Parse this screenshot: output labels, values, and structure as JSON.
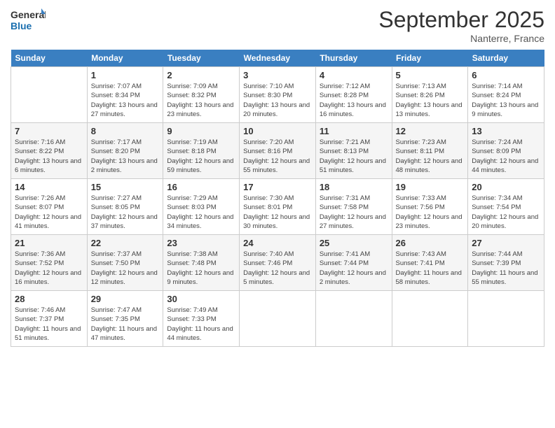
{
  "logo": {
    "line1": "General",
    "line2": "Blue"
  },
  "title": "September 2025",
  "subtitle": "Nanterre, France",
  "days": [
    "Sunday",
    "Monday",
    "Tuesday",
    "Wednesday",
    "Thursday",
    "Friday",
    "Saturday"
  ],
  "weeks": [
    [
      {
        "date": "",
        "sunrise": "",
        "sunset": "",
        "daylight": ""
      },
      {
        "date": "1",
        "sunrise": "7:07 AM",
        "sunset": "8:34 PM",
        "daylight": "13 hours and 27 minutes."
      },
      {
        "date": "2",
        "sunrise": "7:09 AM",
        "sunset": "8:32 PM",
        "daylight": "13 hours and 23 minutes."
      },
      {
        "date": "3",
        "sunrise": "7:10 AM",
        "sunset": "8:30 PM",
        "daylight": "13 hours and 20 minutes."
      },
      {
        "date": "4",
        "sunrise": "7:12 AM",
        "sunset": "8:28 PM",
        "daylight": "13 hours and 16 minutes."
      },
      {
        "date": "5",
        "sunrise": "7:13 AM",
        "sunset": "8:26 PM",
        "daylight": "13 hours and 13 minutes."
      },
      {
        "date": "6",
        "sunrise": "7:14 AM",
        "sunset": "8:24 PM",
        "daylight": "13 hours and 9 minutes."
      }
    ],
    [
      {
        "date": "7",
        "sunrise": "7:16 AM",
        "sunset": "8:22 PM",
        "daylight": "13 hours and 6 minutes."
      },
      {
        "date": "8",
        "sunrise": "7:17 AM",
        "sunset": "8:20 PM",
        "daylight": "13 hours and 2 minutes."
      },
      {
        "date": "9",
        "sunrise": "7:19 AM",
        "sunset": "8:18 PM",
        "daylight": "12 hours and 59 minutes."
      },
      {
        "date": "10",
        "sunrise": "7:20 AM",
        "sunset": "8:16 PM",
        "daylight": "12 hours and 55 minutes."
      },
      {
        "date": "11",
        "sunrise": "7:21 AM",
        "sunset": "8:13 PM",
        "daylight": "12 hours and 51 minutes."
      },
      {
        "date": "12",
        "sunrise": "7:23 AM",
        "sunset": "8:11 PM",
        "daylight": "12 hours and 48 minutes."
      },
      {
        "date": "13",
        "sunrise": "7:24 AM",
        "sunset": "8:09 PM",
        "daylight": "12 hours and 44 minutes."
      }
    ],
    [
      {
        "date": "14",
        "sunrise": "7:26 AM",
        "sunset": "8:07 PM",
        "daylight": "12 hours and 41 minutes."
      },
      {
        "date": "15",
        "sunrise": "7:27 AM",
        "sunset": "8:05 PM",
        "daylight": "12 hours and 37 minutes."
      },
      {
        "date": "16",
        "sunrise": "7:29 AM",
        "sunset": "8:03 PM",
        "daylight": "12 hours and 34 minutes."
      },
      {
        "date": "17",
        "sunrise": "7:30 AM",
        "sunset": "8:01 PM",
        "daylight": "12 hours and 30 minutes."
      },
      {
        "date": "18",
        "sunrise": "7:31 AM",
        "sunset": "7:58 PM",
        "daylight": "12 hours and 27 minutes."
      },
      {
        "date": "19",
        "sunrise": "7:33 AM",
        "sunset": "7:56 PM",
        "daylight": "12 hours and 23 minutes."
      },
      {
        "date": "20",
        "sunrise": "7:34 AM",
        "sunset": "7:54 PM",
        "daylight": "12 hours and 20 minutes."
      }
    ],
    [
      {
        "date": "21",
        "sunrise": "7:36 AM",
        "sunset": "7:52 PM",
        "daylight": "12 hours and 16 minutes."
      },
      {
        "date": "22",
        "sunrise": "7:37 AM",
        "sunset": "7:50 PM",
        "daylight": "12 hours and 12 minutes."
      },
      {
        "date": "23",
        "sunrise": "7:38 AM",
        "sunset": "7:48 PM",
        "daylight": "12 hours and 9 minutes."
      },
      {
        "date": "24",
        "sunrise": "7:40 AM",
        "sunset": "7:46 PM",
        "daylight": "12 hours and 5 minutes."
      },
      {
        "date": "25",
        "sunrise": "7:41 AM",
        "sunset": "7:44 PM",
        "daylight": "12 hours and 2 minutes."
      },
      {
        "date": "26",
        "sunrise": "7:43 AM",
        "sunset": "7:41 PM",
        "daylight": "11 hours and 58 minutes."
      },
      {
        "date": "27",
        "sunrise": "7:44 AM",
        "sunset": "7:39 PM",
        "daylight": "11 hours and 55 minutes."
      }
    ],
    [
      {
        "date": "28",
        "sunrise": "7:46 AM",
        "sunset": "7:37 PM",
        "daylight": "11 hours and 51 minutes."
      },
      {
        "date": "29",
        "sunrise": "7:47 AM",
        "sunset": "7:35 PM",
        "daylight": "11 hours and 47 minutes."
      },
      {
        "date": "30",
        "sunrise": "7:49 AM",
        "sunset": "7:33 PM",
        "daylight": "11 hours and 44 minutes."
      },
      {
        "date": "",
        "sunrise": "",
        "sunset": "",
        "daylight": ""
      },
      {
        "date": "",
        "sunrise": "",
        "sunset": "",
        "daylight": ""
      },
      {
        "date": "",
        "sunrise": "",
        "sunset": "",
        "daylight": ""
      },
      {
        "date": "",
        "sunrise": "",
        "sunset": "",
        "daylight": ""
      }
    ]
  ]
}
